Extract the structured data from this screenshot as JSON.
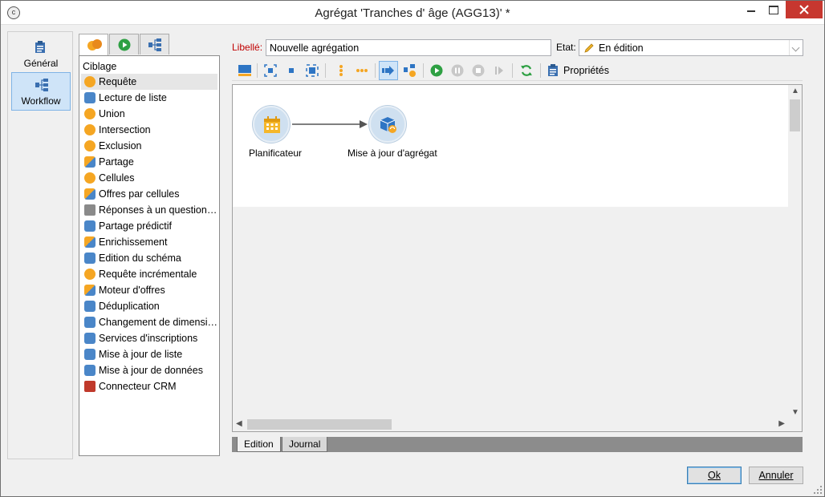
{
  "window": {
    "title": "Agrégat 'Tranches d' âge (AGG13)' *"
  },
  "leftnav": {
    "items": [
      {
        "label": "Général",
        "icon": "clipboard-icon"
      },
      {
        "label": "Workflow",
        "icon": "workflow-icon",
        "selected": true
      }
    ]
  },
  "palette": {
    "tabs": [
      "targeting-tab",
      "flow-control-tab",
      "actions-tab"
    ],
    "section": "Ciblage",
    "items": [
      {
        "label": "Requête",
        "selected": true
      },
      {
        "label": "Lecture de liste"
      },
      {
        "label": "Union"
      },
      {
        "label": "Intersection"
      },
      {
        "label": "Exclusion"
      },
      {
        "label": "Partage"
      },
      {
        "label": "Cellules"
      },
      {
        "label": "Offres par cellules"
      },
      {
        "label": "Réponses à un questionna..."
      },
      {
        "label": "Partage prédictif"
      },
      {
        "label": "Enrichissement"
      },
      {
        "label": "Edition du schéma"
      },
      {
        "label": "Requête incrémentale"
      },
      {
        "label": "Moteur d'offres"
      },
      {
        "label": "Déduplication"
      },
      {
        "label": "Changement de dimension"
      },
      {
        "label": "Services d'inscriptions"
      },
      {
        "label": "Mise à jour de liste"
      },
      {
        "label": "Mise à jour de données"
      },
      {
        "label": "Connecteur CRM"
      }
    ]
  },
  "form": {
    "libelle_label": "Libellé:",
    "libelle_value": "Nouvelle agrégation",
    "etat_label": "Etat:",
    "etat_value": "En édition"
  },
  "toolbar": {
    "properties_label": "Propriétés"
  },
  "canvas": {
    "nodes": [
      {
        "label": "Planificateur",
        "icon": "calendar-icon"
      },
      {
        "label": "Mise à jour d'agrégat",
        "icon": "cube-update-icon"
      }
    ]
  },
  "bottom_tabs": {
    "edition": "Edition",
    "journal": "Journal"
  },
  "buttons": {
    "ok": "Ok",
    "cancel": "Annuler"
  },
  "colors": {
    "accent": "#f5a623",
    "selection": "#cfe4f8",
    "libelle_label": "#c00000"
  }
}
